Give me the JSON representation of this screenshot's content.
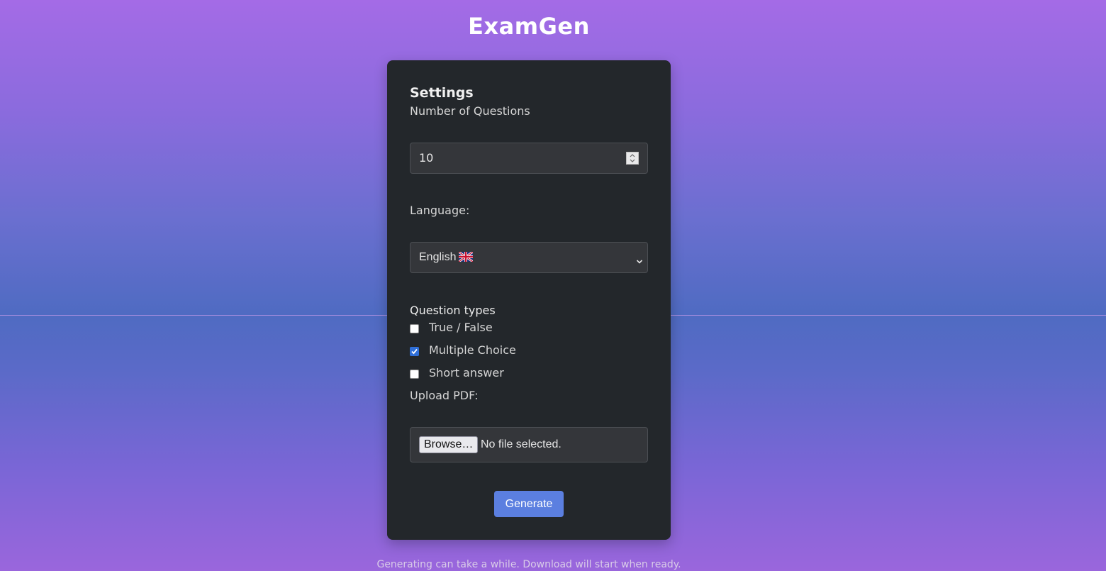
{
  "app": {
    "title": "ExamGen"
  },
  "settings": {
    "title": "Settings",
    "num_questions_label": "Number of Questions",
    "num_questions_value": "10",
    "language_label": "Language:",
    "language_selected": "English",
    "language_flag": "uk-flag-icon",
    "question_types_label": "Question types",
    "question_types": [
      {
        "label": "True / False",
        "checked": false
      },
      {
        "label": "Multiple Choice",
        "checked": true
      },
      {
        "label": "Short answer",
        "checked": false
      }
    ],
    "upload_label": "Upload PDF:",
    "browse_label": "Browse…",
    "file_status": "No file selected.",
    "generate_label": "Generate"
  },
  "footer": {
    "note": "Generating can take a while. Download will start when ready."
  },
  "colors": {
    "card_bg": "#23272b",
    "accent": "#5b7fe0",
    "checkbox_checked": "#2f6fd8"
  }
}
